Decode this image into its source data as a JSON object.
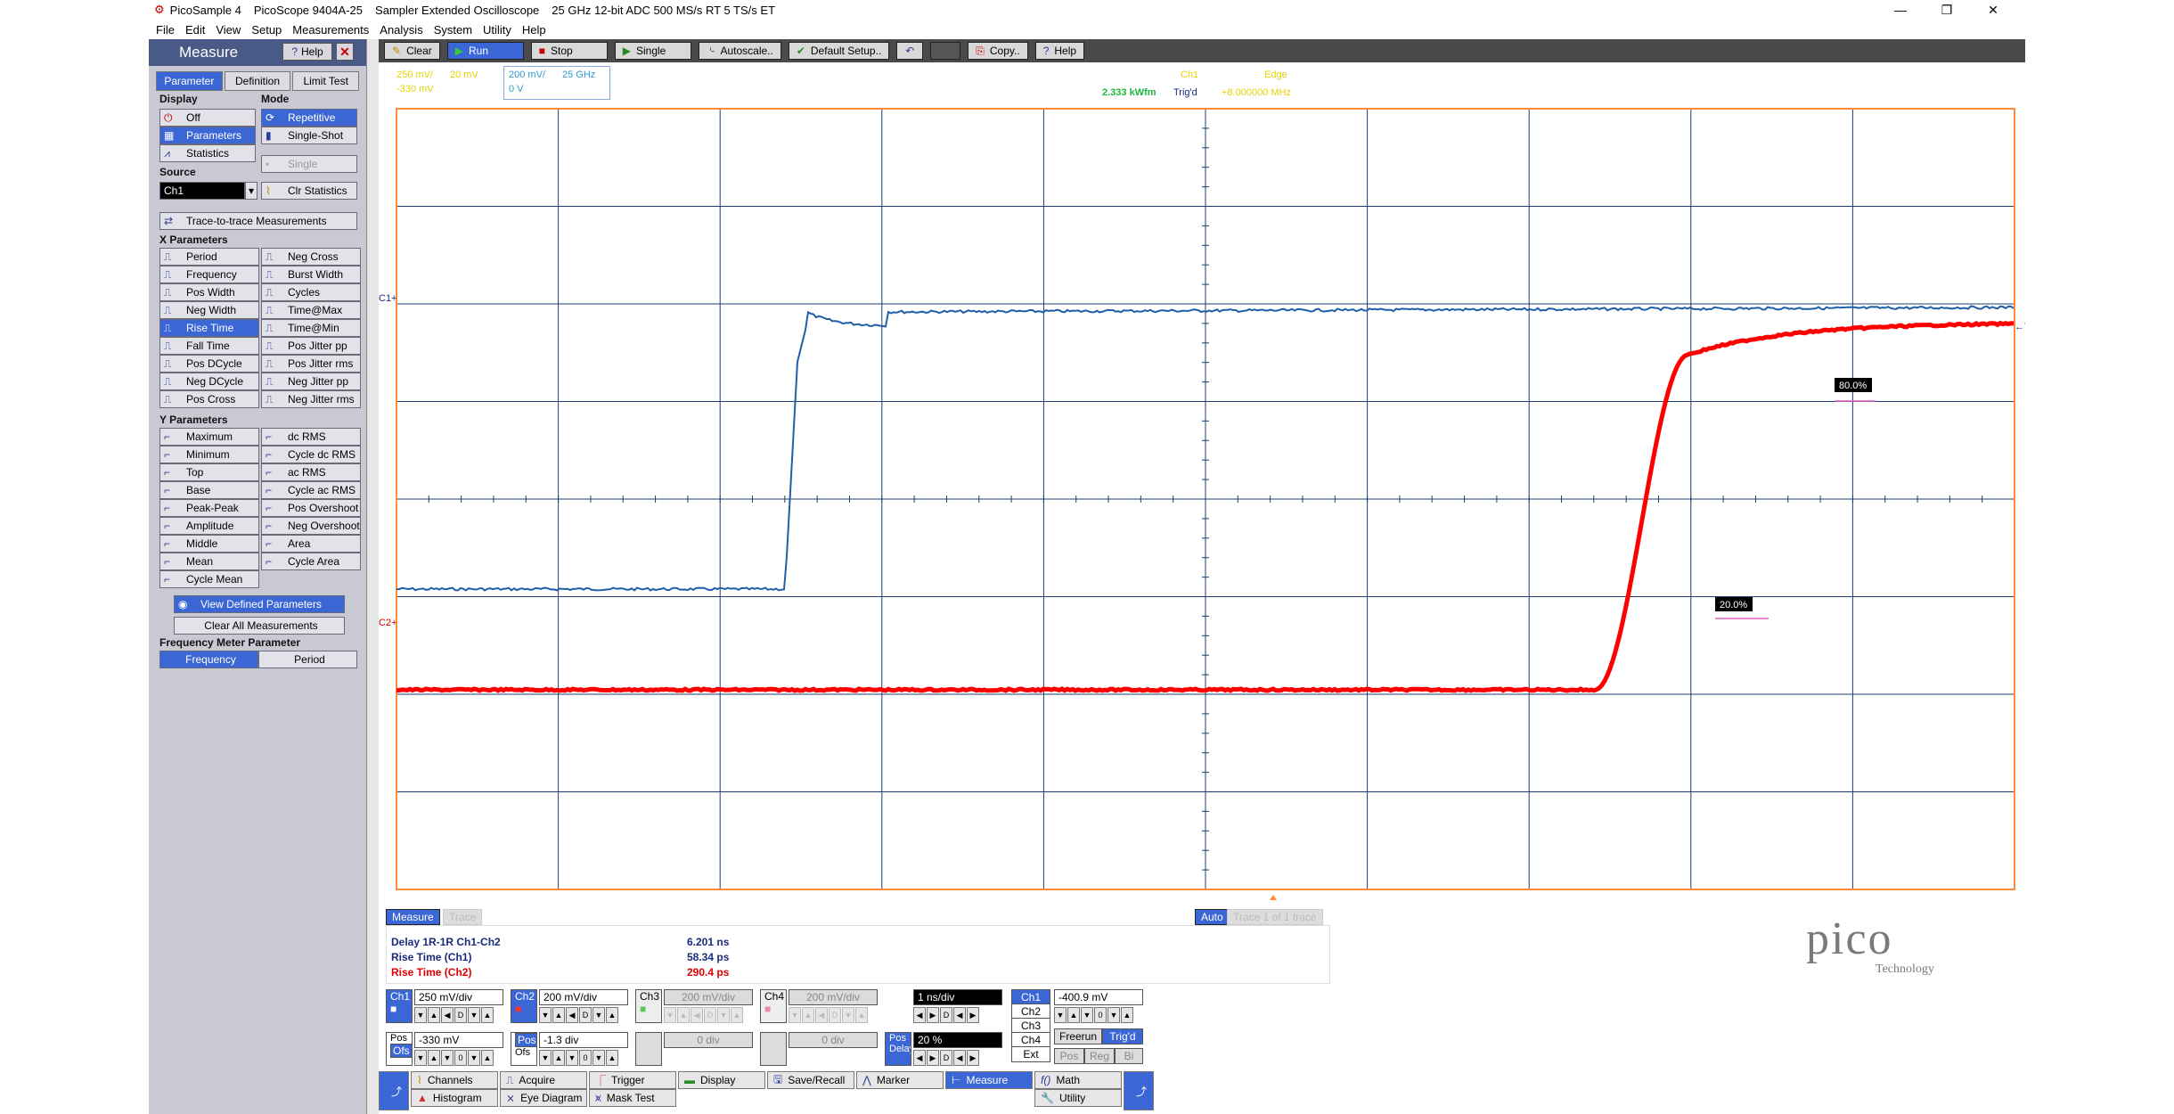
{
  "window": {
    "app_name": "PicoSample 4",
    "device": "PicoScope 9404A-25",
    "mode": "Sampler Extended Oscilloscope",
    "spec": "25 GHz  12-bit ADC  500 MS/s RT  5 TS/s ET",
    "minimize": "—",
    "restore": "❐",
    "close": "✕"
  },
  "menu": [
    "File",
    "Edit",
    "View",
    "Setup",
    "Measurements",
    "Analysis",
    "System",
    "Utility",
    "Help"
  ],
  "toolbar": {
    "clear": "Clear",
    "run": "Run",
    "stop": "Stop",
    "single": "Single",
    "autoscale": "Autoscale..",
    "default_setup": "Default Setup..",
    "copy": "Copy..",
    "help": "Help"
  },
  "measure_panel": {
    "title": "Measure",
    "help": "Help",
    "close": "✕",
    "tabs": [
      "Parameter",
      "Definition",
      "Limit Test"
    ],
    "display_label": "Display",
    "mode_label": "Mode",
    "display_off": "Off",
    "display_parameters": "Parameters",
    "display_statistics": "Statistics",
    "mode_repetitive": "Repetitive",
    "mode_single_shot": "Single-Shot",
    "mode_single": "Single",
    "source_label": "Source",
    "source_value": "Ch1",
    "clr_statistics": "Clr Statistics",
    "trace_to_trace": "Trace-to-trace Measurements",
    "x_params_label": "X Parameters",
    "x_params": [
      [
        "Period",
        "Neg Cross"
      ],
      [
        "Frequency",
        "Burst Width"
      ],
      [
        "Pos Width",
        "Cycles"
      ],
      [
        "Neg Width",
        "Time@Max"
      ],
      [
        "Rise Time",
        "Time@Min"
      ],
      [
        "Fall Time",
        "Pos Jitter pp"
      ],
      [
        "Pos DCycle",
        "Pos Jitter rms"
      ],
      [
        "Neg DCycle",
        "Neg Jitter pp"
      ],
      [
        "Pos Cross",
        "Neg Jitter rms"
      ]
    ],
    "y_params_label": "Y Parameters",
    "y_params": [
      [
        "Maximum",
        "dc RMS"
      ],
      [
        "Minimum",
        "Cycle dc RMS"
      ],
      [
        "Top",
        "ac RMS"
      ],
      [
        "Base",
        "Cycle ac RMS"
      ],
      [
        "Peak-Peak",
        "Pos Overshoot"
      ],
      [
        "Amplitude",
        "Neg Overshoot"
      ],
      [
        "Middle",
        "Area"
      ],
      [
        "Mean",
        "Cycle Area"
      ],
      [
        "Cycle Mean",
        ""
      ]
    ],
    "view_defined": "View Defined Parameters",
    "clear_all": "Clear All Measurements",
    "freq_meter_label": "Frequency Meter Parameter",
    "freq_tabs": [
      "Frequency",
      "Period"
    ]
  },
  "status": {
    "ch1_a": "250 mV/",
    "ch1_b": "20 mV",
    "ch1_c": "-330 mV",
    "ch2_a": "200 mV/",
    "ch2_b": "25 GHz",
    "ch2_c": "0 V",
    "wfm_rate": "2.333 kWfm",
    "trig": "Trig'd",
    "trig_a": "Ch1",
    "trig_b": "Edge",
    "trig_c": "+8.000000 MHz"
  },
  "scope": {
    "markers": {
      "c1": "C1+",
      "c2": "C2+",
      "trig": "←T"
    },
    "labels": {
      "high": "80.0%",
      "low": "20.0%"
    },
    "colors": {
      "ch1": "#1f5fa8",
      "ch2": "#ff0000",
      "grid": "#1c3f6e",
      "border": "#ff8c3a"
    }
  },
  "measurements": {
    "tab": "Measure",
    "tab2": "Trace",
    "auto": "Auto",
    "auto2": "Trace 1 of 1 trace",
    "rows": [
      {
        "label": "Delay 1R-1R  Ch1-Ch2",
        "value": "6.201 ns",
        "color": "#1a2a7a"
      },
      {
        "label": "Rise Time (Ch1)",
        "value": "58.34 ps",
        "color": "#1a2a7a"
      },
      {
        "label": "Rise Time (Ch2)",
        "value": "290.4 ps",
        "color": "#e00000"
      }
    ]
  },
  "controls": {
    "ch1": "Ch1",
    "ch1_scale": "250 mV/div",
    "ch1_pos": "Pos",
    "ch1_ofs": "Ofs",
    "ch1_offset": "-330 mV",
    "ch2": "Ch2",
    "ch2_scale": "200 mV/div",
    "ch2_pos": "Pos",
    "ch2_ofs": "Ofs",
    "ch2_offset": "-1.3 div",
    "ch3": "Ch3",
    "ch3_scale": "200 mV/div",
    "ch3_offset": "0 div",
    "ch4": "Ch4",
    "ch4_scale": "200 mV/div",
    "ch4_offset": "0 div",
    "timebase": "1 ns/div",
    "delay_label": "Delay",
    "delay_pos": "Pos",
    "delay_value": "20 %",
    "trig_ch1": "Ch1",
    "trig_ch2": "Ch2",
    "trig_ch3": "Ch3",
    "trig_ch4": "Ch4",
    "trig_ext": "Ext",
    "trig_level": "-400.9 mV",
    "freerun": "Freerun",
    "trigd": "Trig'd",
    "trig_pos": "Pos",
    "trig_reg": "Reg",
    "trig_bi": "Bi",
    "arrow_d": "D",
    "arrow_0": "0"
  },
  "bottom_tabs": {
    "channels": "Channels",
    "acquire": "Acquire",
    "trigger": "Trigger",
    "display": "Display",
    "save_recall": "Save/Recall",
    "marker": "Marker",
    "measure": "Measure",
    "math": "Math",
    "histogram": "Histogram",
    "eye_diagram": "Eye Diagram",
    "mask_test": "Mask Test",
    "utility": "Utility"
  },
  "logo": {
    "text": "pico",
    "sub": "Technology"
  }
}
